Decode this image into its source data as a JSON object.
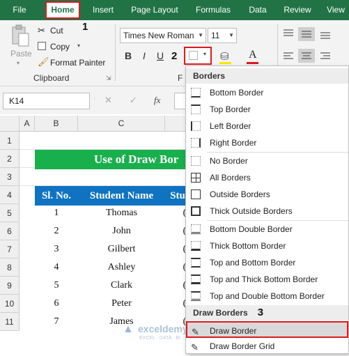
{
  "tabs": [
    "File",
    "Home",
    "Insert",
    "Page Layout",
    "Formulas",
    "Data",
    "Review",
    "View"
  ],
  "steps": [
    "1",
    "2",
    "3"
  ],
  "clipboard": {
    "paste": "Paste",
    "cut": "Cut",
    "copy": "Copy",
    "format_painter": "Format Painter",
    "group": "Clipboard"
  },
  "font": {
    "name": "Times New Roman",
    "size": "11",
    "bold": "B",
    "italic": "I",
    "group_initial": "F"
  },
  "formula_bar": {
    "namebox": "K14",
    "fx": "fx"
  },
  "columns": [
    "A",
    "B",
    "C"
  ],
  "rows": [
    "1",
    "2",
    "3",
    "4",
    "5",
    "6",
    "7",
    "8",
    "9",
    "10",
    "11"
  ],
  "sheet": {
    "title": "Use of Draw Bor",
    "headers": [
      "Sl. No.",
      "Student Name",
      "Stu"
    ],
    "records": [
      {
        "no": "1",
        "name": "Thomas"
      },
      {
        "no": "2",
        "name": "John"
      },
      {
        "no": "3",
        "name": "Gilbert"
      },
      {
        "no": "4",
        "name": "Ashley"
      },
      {
        "no": "5",
        "name": "Clark"
      },
      {
        "no": "6",
        "name": "Peter"
      },
      {
        "no": "7",
        "name": "James"
      }
    ]
  },
  "menu": {
    "borders_header": "Borders",
    "items": [
      "Bottom Border",
      "Top Border",
      "Left Border",
      "Right Border",
      "No Border",
      "All Borders",
      "Outside Borders",
      "Thick Outside Borders",
      "Bottom Double Border",
      "Thick Bottom Border",
      "Top and Bottom Border",
      "Top and Thick Bottom Border",
      "Top and Double Bottom Border"
    ],
    "draw_header": "Draw Borders",
    "draw_items": [
      "Draw Border",
      "Draw Border Grid"
    ]
  },
  "watermark": {
    "brand": "exceldemy",
    "tagline": "EXCEL · DATA · BI"
  },
  "colors": {
    "excel_green": "#217346",
    "title_green": "#18b04c",
    "header_blue": "#0f73c2",
    "highlight_red": "#e0191c"
  }
}
